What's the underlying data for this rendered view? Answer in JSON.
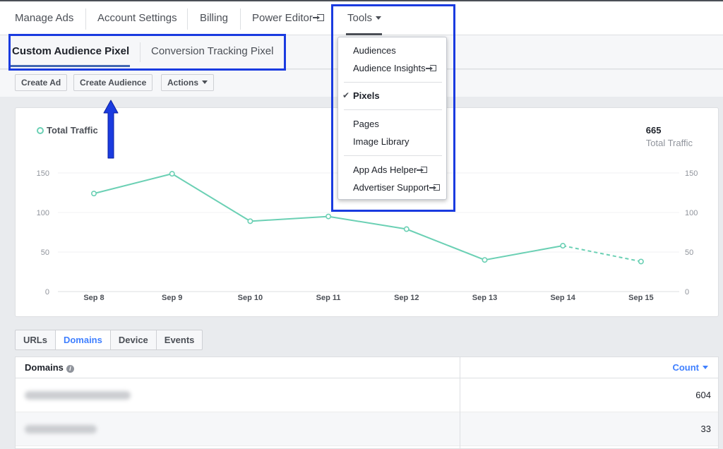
{
  "topnav": {
    "items": [
      {
        "label": "Manage Ads",
        "external": false
      },
      {
        "label": "Account Settings",
        "external": false
      },
      {
        "label": "Billing",
        "external": false
      },
      {
        "label": "Power Editor",
        "external": true
      },
      {
        "label": "Tools",
        "dropdown": true,
        "active": true
      }
    ]
  },
  "subtabs": {
    "items": [
      {
        "label": "Custom Audience Pixel",
        "active": true
      },
      {
        "label": "Conversion Tracking Pixel",
        "active": false
      }
    ]
  },
  "actions": {
    "create_ad": "Create Ad",
    "create_audience": "Create Audience",
    "actions_menu": "Actions"
  },
  "tools_menu": {
    "groups": [
      [
        {
          "label": "Audiences"
        },
        {
          "label": "Audience Insights",
          "external": true
        }
      ],
      [
        {
          "label": "Pixels",
          "checked": true
        }
      ],
      [
        {
          "label": "Pages"
        },
        {
          "label": "Image Library"
        }
      ],
      [
        {
          "label": "App Ads Helper",
          "external": true
        },
        {
          "label": "Advertiser Support",
          "external": true
        }
      ]
    ]
  },
  "chart": {
    "legend_label": "Total Traffic",
    "total_value": "665",
    "total_label": "Total Traffic"
  },
  "chart_data": {
    "type": "line",
    "x": [
      "Sep 8",
      "Sep 9",
      "Sep 10",
      "Sep 11",
      "Sep 12",
      "Sep 13",
      "Sep 14",
      "Sep 15"
    ],
    "series": [
      {
        "name": "Total Traffic",
        "values": [
          124,
          149,
          89,
          95,
          79,
          40,
          58,
          38
        ],
        "dashed_from_index": 6
      }
    ],
    "yticks": [
      0,
      50,
      100,
      150
    ],
    "ylim": [
      0,
      150
    ],
    "grid": true,
    "color": "#6bd0b4"
  },
  "bottom_tabs": {
    "items": [
      {
        "label": "URLs",
        "active": false
      },
      {
        "label": "Domains",
        "active": true
      },
      {
        "label": "Device",
        "active": false
      },
      {
        "label": "Events",
        "active": false
      }
    ]
  },
  "table": {
    "col_domains": "Domains",
    "col_count": "Count",
    "rows": [
      {
        "count": "604"
      },
      {
        "count": "33"
      }
    ]
  },
  "colors": {
    "accent": "#4080ff",
    "annotation": "#1a3be0",
    "series": "#6bd0b4"
  }
}
